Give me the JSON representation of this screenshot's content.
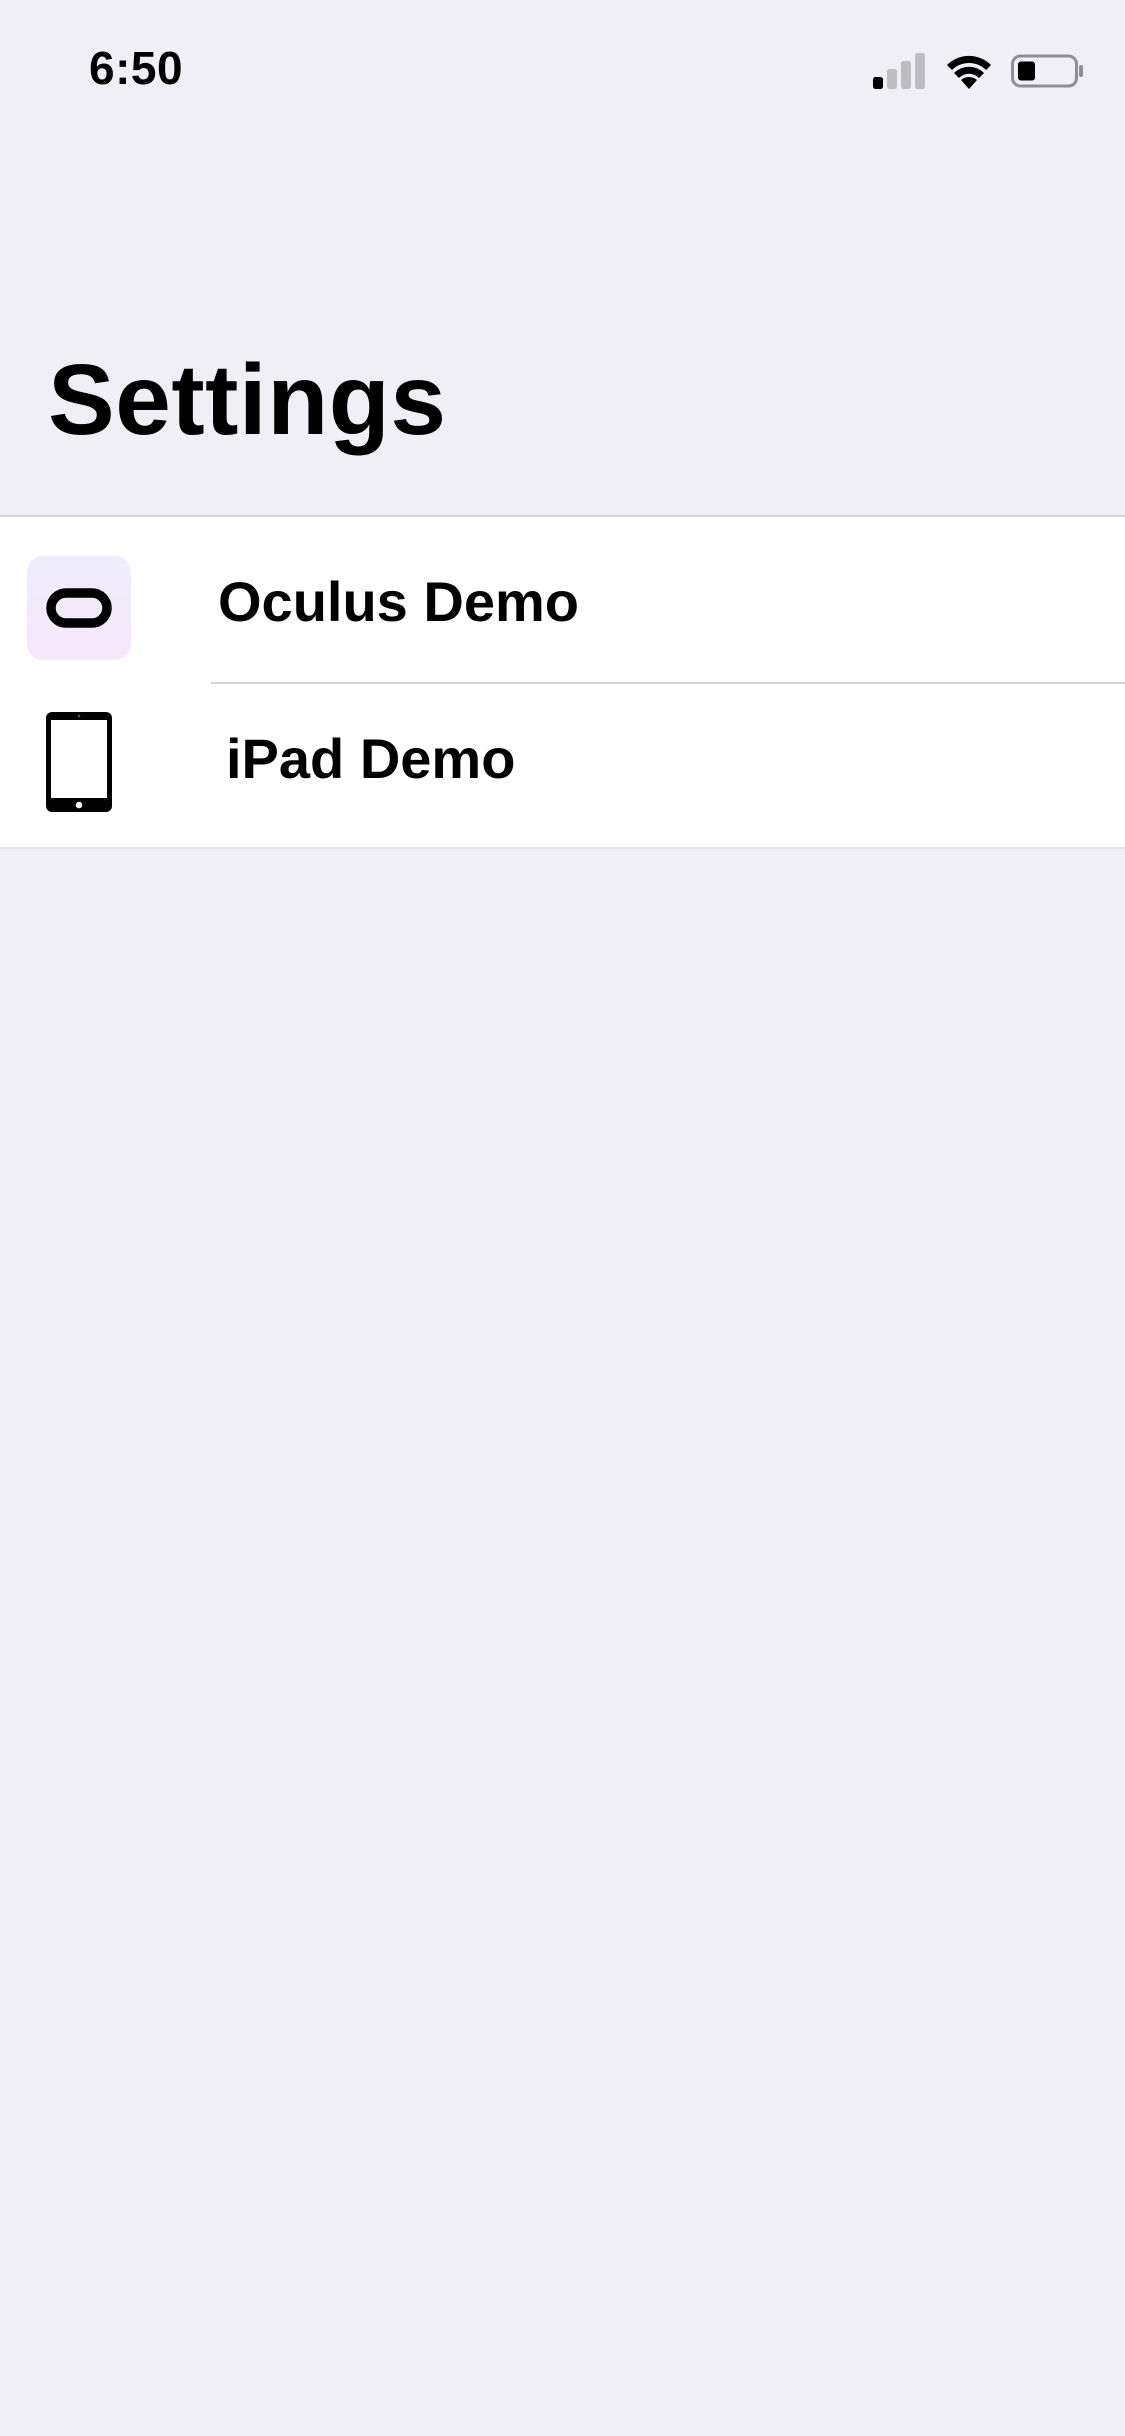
{
  "status_bar": {
    "time": "6:50",
    "icons": [
      "cellular-signal-icon",
      "wifi-icon",
      "battery-icon"
    ]
  },
  "header": {
    "title": "Settings"
  },
  "settings_list": {
    "items": [
      {
        "label": "Oculus Demo",
        "icon": "oculus-headset-icon"
      },
      {
        "label": "iPad Demo",
        "icon": "ipad-icon"
      }
    ]
  },
  "colors": {
    "background": "#f0eff5",
    "list_background": "#ffffff",
    "separator": "#d6d6da",
    "text": "#000000"
  }
}
